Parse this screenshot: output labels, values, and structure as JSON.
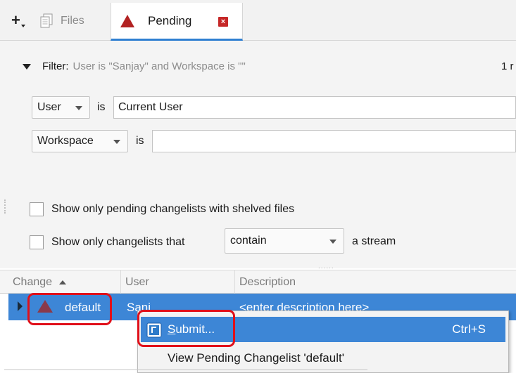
{
  "tabs": {
    "add_label": "+",
    "files_label": "Files",
    "pending_label": "Pending",
    "pending_close": "×"
  },
  "filter": {
    "label": "Filter:",
    "description": "User is \"Sanjay\" and Workspace is \"\"",
    "count": "1 r",
    "user_dropdown": "User",
    "user_is": "is",
    "user_value": "Current User",
    "workspace_dropdown": "Workspace",
    "workspace_is": "is",
    "workspace_value": ""
  },
  "options": {
    "shelved_label": "Show only pending changelists with shelved files",
    "stream_label": "Show only changelists that",
    "stream_select": "contain",
    "stream_suffix": "a stream",
    "splitter": "......"
  },
  "table": {
    "columns": [
      "Change",
      "User",
      "Description"
    ],
    "rows": [
      {
        "change": "default",
        "user": "Sanj",
        "description": "<enter description here>"
      }
    ]
  },
  "context_menu": {
    "items": [
      {
        "label_first": "S",
        "label_rest": "ubmit...",
        "shortcut": "Ctrl+S"
      },
      {
        "label": "View Pending Changelist 'default'"
      }
    ]
  },
  "colors": {
    "selection": "#3d86d6",
    "accent_tab": "#2f7fd1",
    "annotation": "#e0101a",
    "warning_triangle": "#b22222"
  }
}
